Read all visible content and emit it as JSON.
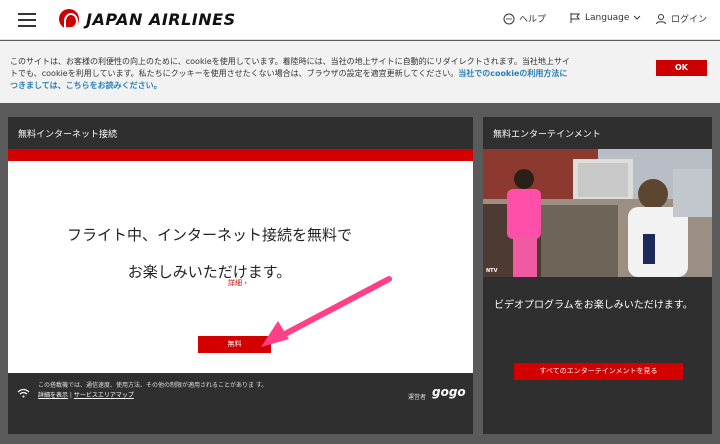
{
  "header": {
    "logo": "JAPAN AIRLINES",
    "help": "ヘルプ",
    "language": "Language",
    "login": "ログイン"
  },
  "cookie": {
    "text": "このサイトは、お客様の利便性の向上のために、cookieを使用しています。着陸時には、当社の地上サイトに自動的にリダイレクトされます。当社地上サイトでも、cookieを利用しています。私たちにクッキーを使用させたくない場合は、ブラウザの設定を適宜更新してください。",
    "link": "当社でのcookieの利用方法につきましては、こちらをお読みください。",
    "ok_label": "OK"
  },
  "wifi": {
    "title": "無料インターネット接続",
    "heading_line1": "フライト中、インターネット接続を無料で",
    "heading_line2": "お楽しみいただけます。",
    "detail": "詳細 ›",
    "button": "無料",
    "footer_text": "この搭載機では、通信速度、使用方法、その他の制限が適用されることがありま す。",
    "footer_link1": "詳細を表示",
    "footer_link2": "サービスエリアマップ",
    "operator": "運営者",
    "operator_name": "gogo"
  },
  "entertainment": {
    "title": "無料エンターテインメント",
    "caption": "NTV",
    "text": "ビデオプログラムをお楽しみいただけます。",
    "button": "すべてのエンターテインメントを見る"
  },
  "colors": {
    "accent": "#d40000",
    "panel": "#2f2f2f",
    "cookie_link": "#2a7fb5"
  }
}
